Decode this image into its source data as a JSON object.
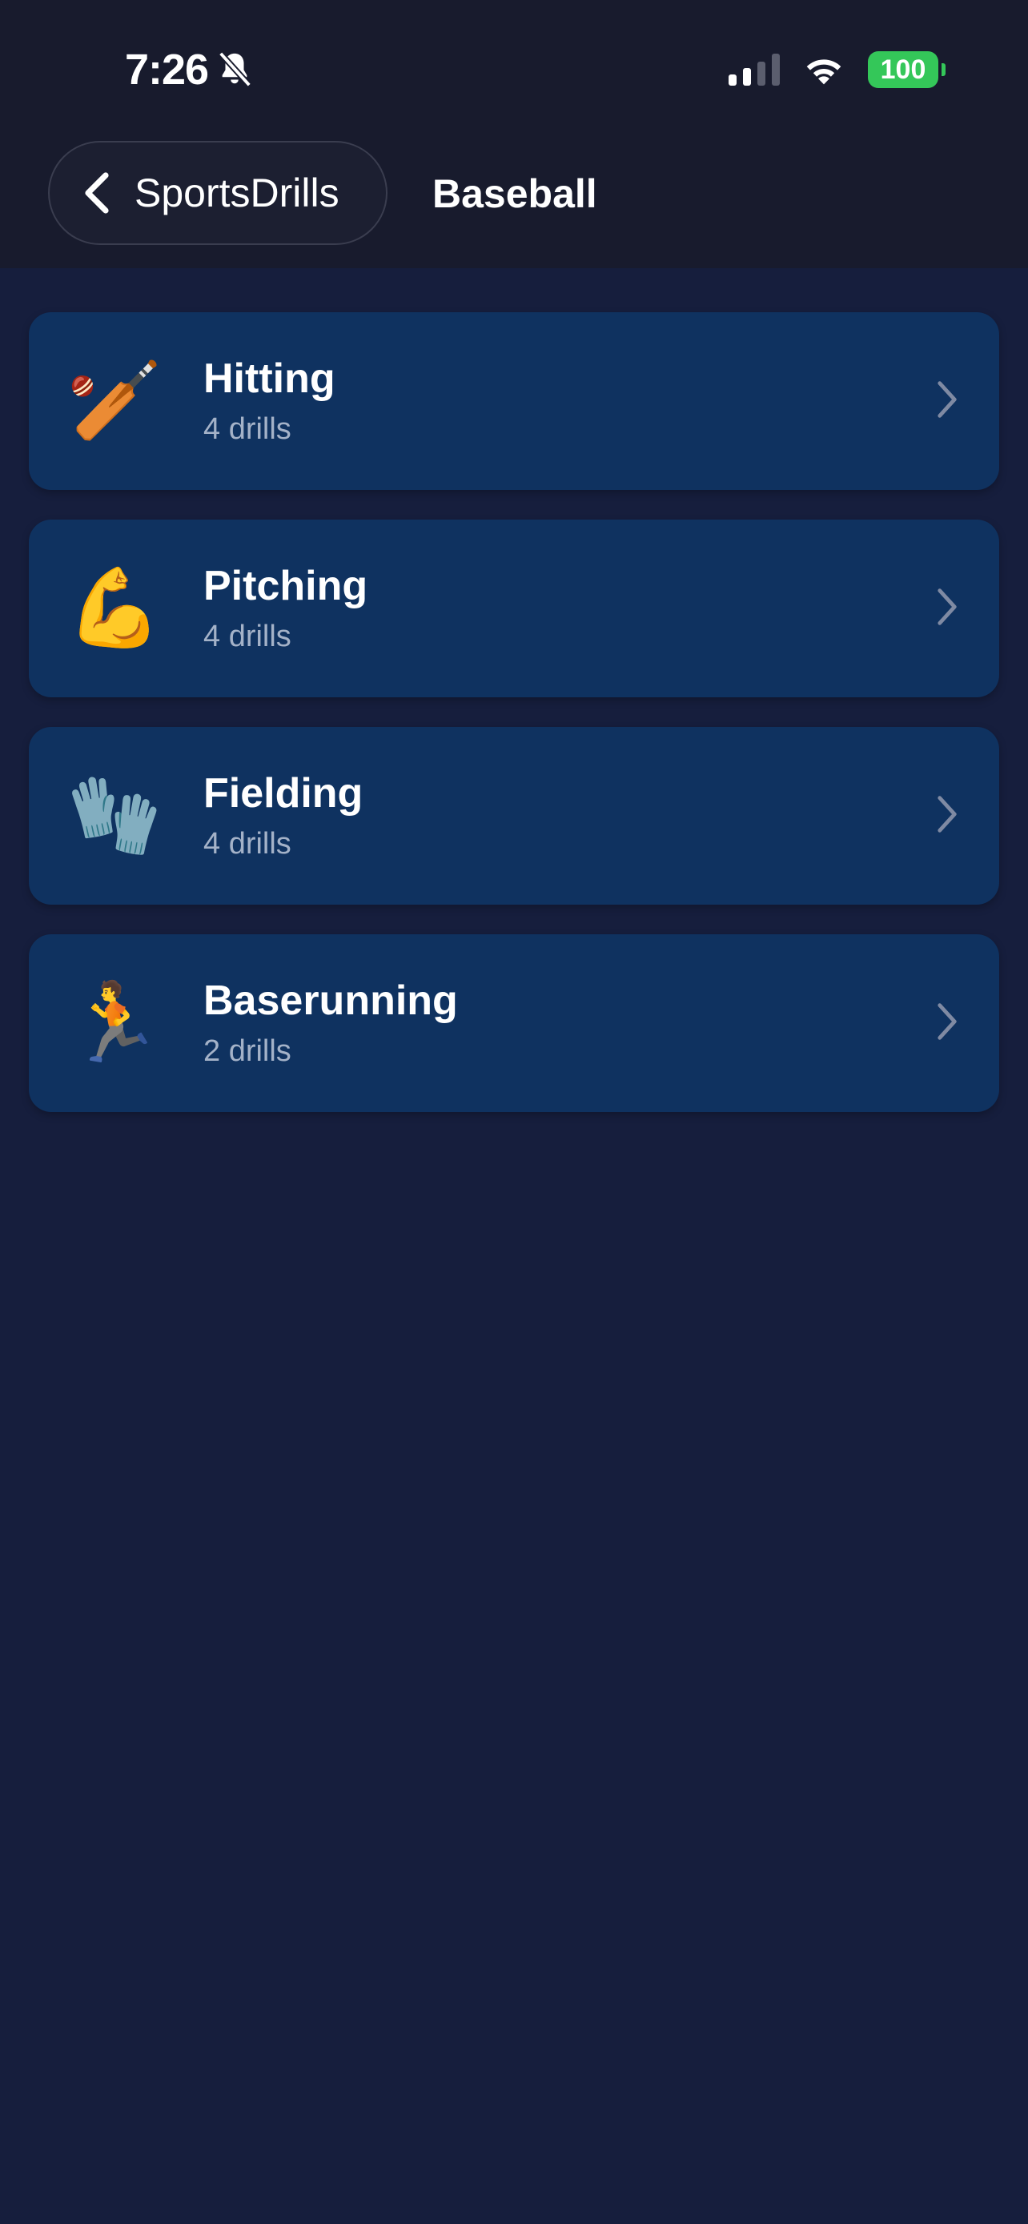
{
  "status_bar": {
    "time": "7:26",
    "battery": "100",
    "colors": {
      "battery": "#34c759",
      "signal_on": "#ffffff",
      "signal_off": "#5b5e6e"
    },
    "icons": [
      "bell-slash-icon",
      "cellular-signal-icon",
      "wifi-icon",
      "battery-icon"
    ]
  },
  "nav": {
    "back_label": "SportsDrills",
    "title": "Baseball",
    "icons": [
      "chevron-left-icon"
    ]
  },
  "categories": [
    {
      "icon": "🏏",
      "icon_name": "cricket-bat-icon",
      "title": "Hitting",
      "subtitle": "4 drills"
    },
    {
      "icon": "💪",
      "icon_name": "flexed-biceps-icon",
      "title": "Pitching",
      "subtitle": "4 drills"
    },
    {
      "icon": "🧤",
      "icon_name": "gloves-icon",
      "title": "Fielding",
      "subtitle": "4 drills"
    },
    {
      "icon": "🏃",
      "icon_name": "person-running-icon",
      "title": "Baserunning",
      "subtitle": "2 drills"
    }
  ],
  "colors": {
    "background": "#161e3d",
    "header": "#181b2d",
    "card": "#0f3260",
    "subtitle": "#a4b2c8",
    "chevron": "#7f8aa3"
  }
}
